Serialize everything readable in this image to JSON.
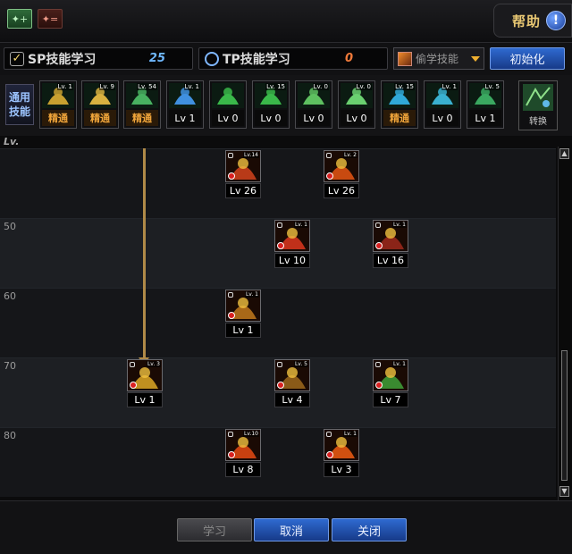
{
  "topbar": {
    "tab_a_icon": "skill-tab-icon",
    "tab_b_icon": "skill-tab-alt-icon",
    "help_label": "帮助",
    "help_icon": "!"
  },
  "points": {
    "sp_label": "SP技能学习",
    "sp_value": "25",
    "tp_label": "TP技能学习",
    "tp_value": "0",
    "steal_label": "偷学技能",
    "init_label": "初始化"
  },
  "general": {
    "label": "通用技能",
    "items": [
      {
        "lv": "Lv. 1",
        "foot": "精通",
        "type": "master",
        "color": "#c8a030"
      },
      {
        "lv": "Lv. 9",
        "foot": "精通",
        "type": "master",
        "color": "#d8b040"
      },
      {
        "lv": "Lv. 54",
        "foot": "精通",
        "type": "master",
        "color": "#48b060"
      },
      {
        "lv": "Lv. 1",
        "foot": "Lv 1",
        "type": "lvl",
        "color": "#4090e0"
      },
      {
        "lv": "",
        "foot": "Lv 0",
        "type": "lvl",
        "color": "#3ab84a"
      },
      {
        "lv": "Lv. 15",
        "foot": "Lv 0",
        "type": "lvl",
        "color": "#3ab84a"
      },
      {
        "lv": "Lv. 0",
        "foot": "Lv 0",
        "type": "lvl",
        "color": "#5ec060"
      },
      {
        "lv": "Lv. 0",
        "foot": "Lv 0",
        "type": "lvl",
        "color": "#6ad070"
      },
      {
        "lv": "Lv. 15",
        "foot": "精通",
        "type": "master",
        "color": "#30a8d8"
      },
      {
        "lv": "Lv. 1",
        "foot": "Lv 0",
        "type": "lvl",
        "color": "#3ab0d0"
      },
      {
        "lv": "Lv. 5",
        "foot": "Lv 1",
        "type": "lvl",
        "color": "#3aa860"
      }
    ],
    "switch_label": "转换"
  },
  "tree": {
    "lv_header": "Lv.",
    "band_labels": [
      "",
      "50",
      "60",
      "70",
      "80"
    ],
    "skills": [
      {
        "lv": "Lv 26",
        "badge": "Lv.14",
        "color": "#b83a18"
      },
      {
        "lv": "Lv 26",
        "badge": "Lv. 2",
        "color": "#c84a10"
      },
      {
        "lv": "Lv 10",
        "badge": "Lv. 1",
        "color": "#c0301a"
      },
      {
        "lv": "Lv 16",
        "badge": "Lv. 1",
        "color": "#8a2418"
      },
      {
        "lv": "Lv 1",
        "badge": "Lv. 1",
        "color": "#a86818"
      },
      {
        "lv": "Lv 1",
        "badge": "Lv. 3",
        "color": "#c09020"
      },
      {
        "lv": "Lv 4",
        "badge": "Lv. 5",
        "color": "#8a5a18"
      },
      {
        "lv": "Lv 7",
        "badge": "Lv. 1",
        "color": "#3a8a30"
      },
      {
        "lv": "Lv 8",
        "badge": "Lv.10",
        "color": "#c84010"
      },
      {
        "lv": "Lv 3",
        "badge": "Lv. 1",
        "color": "#d05010"
      }
    ]
  },
  "bottom": {
    "learn_label": "学习",
    "cancel_label": "取消",
    "close_label": "关闭"
  }
}
